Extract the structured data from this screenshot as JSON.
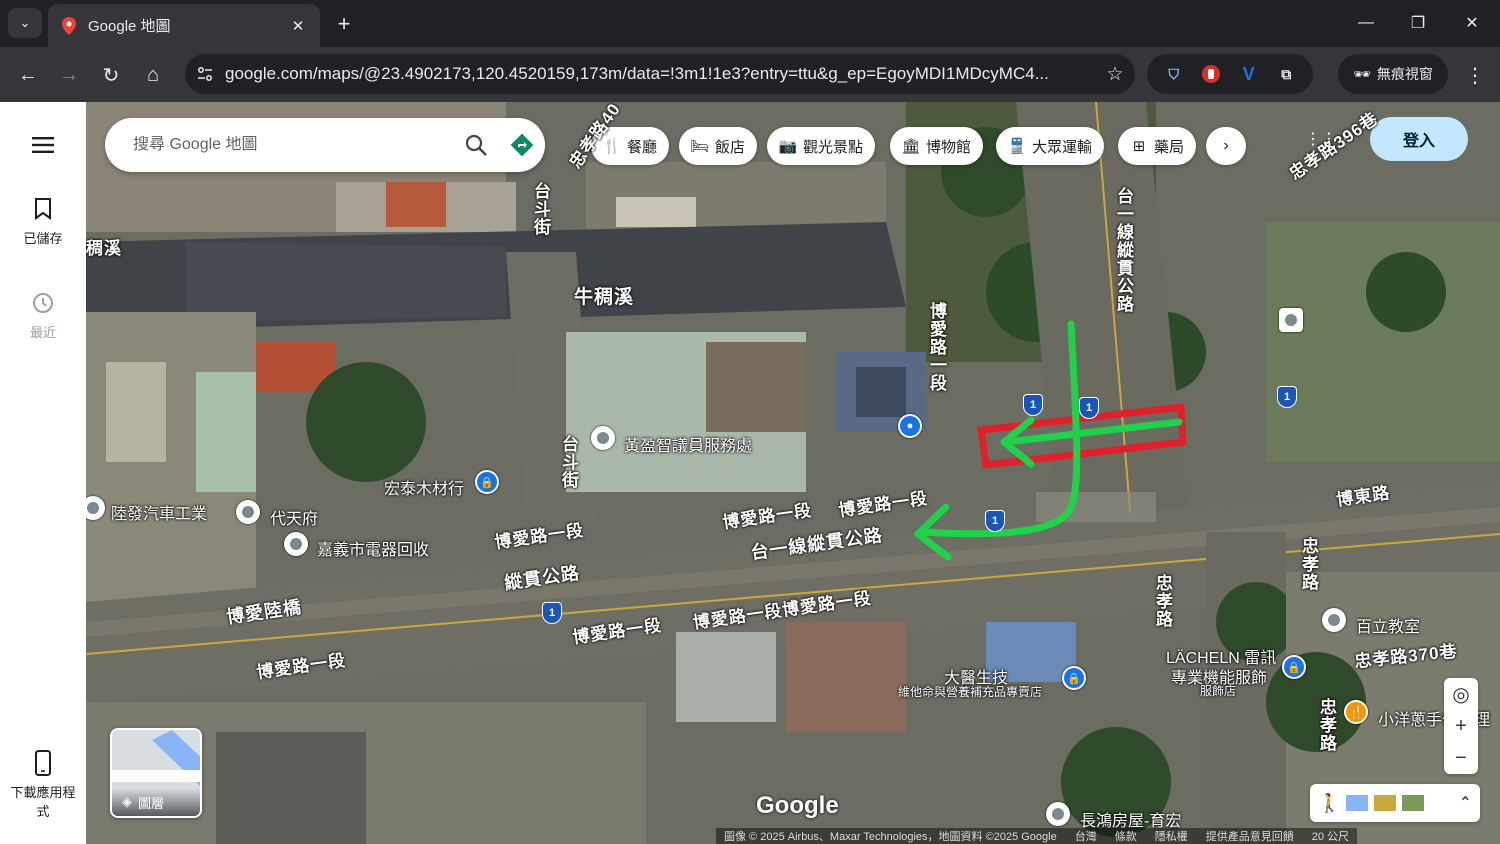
{
  "browser": {
    "tab_title": "Google 地圖",
    "url": "google.com/maps/@23.4902173,120.4520159,173m/data=!3m1!1e3?entry=ttu&g_ep=EgoyMDI1MDcyMC4...",
    "incognito_label": "無痕視窗"
  },
  "rail": {
    "menu_label": "",
    "saved_label": "已儲存",
    "recent_label": "最近",
    "download_label_1": "下載應用程",
    "download_label_2": "式"
  },
  "search": {
    "placeholder": "搜尋 Google 地圖"
  },
  "chips": [
    {
      "label": "餐廳",
      "icon": "restaurant-icon"
    },
    {
      "label": "飯店",
      "icon": "hotel-icon"
    },
    {
      "label": "觀光景點",
      "icon": "camera-icon"
    },
    {
      "label": "博物館",
      "icon": "museum-icon"
    },
    {
      "label": "大眾運輸",
      "icon": "transit-icon"
    },
    {
      "label": "藥局",
      "icon": "pharmacy-icon"
    }
  ],
  "signin_label": "登入",
  "map_labels": {
    "river_left": "稠溪",
    "river": "牛稠溪",
    "road_taidou_1": "台斗街",
    "road_taidou_2": "台斗街",
    "road_zhongxiao_40": "忠孝路40",
    "road_zhongxiao_396": "忠孝路396巷",
    "road_boai_1_vertical": "博愛路一段",
    "road_tai1_vertical": "台一線縱貫公路",
    "poi_huang": "黃盈智議員服務處",
    "poi_hongtai": "宏泰木材行",
    "poi_lufa": "陸發汽車工業",
    "poi_daitian": "代天府",
    "poi_chiayi": "嘉義市電器回收",
    "road_boai_a": "博愛路一段",
    "road_boai_b": "博愛路一段",
    "road_boai_c": "博愛路一段",
    "road_tai1": "台一線縱貫公路",
    "road_zonggun": "縱貫公路",
    "road_boai_bridge": "博愛陸橋",
    "road_boai_d": "博愛路一段",
    "road_boai_e": "博愛路一段",
    "road_boai_f": "博愛路一段博愛路一段",
    "road_bodong": "博東路",
    "road_zhongxiao_a": "忠孝路",
    "road_zhongxiao_b": "忠孝路",
    "road_zhongxiao_c": "忠孝路",
    "poi_baili": "百立教室",
    "road_zhongxiao_370": "忠孝路370巷",
    "poi_lacheln_1": "LÄCHELN 雷訊",
    "poi_lacheln_2": "專業機能服飾",
    "poi_lacheln_3": "服飾店",
    "poi_dayi_1": "大醫生技",
    "poi_dayi_2": "維他命與營養補充品專賣店",
    "poi_xiaoyang": "小洋蔥手作料理",
    "poi_changhong": "長鴻房屋-育宏",
    "layers_label": "圖層",
    "google_logo": "Google"
  },
  "highway_shield": "1",
  "attribution": {
    "imagery": "圖像 © 2025 Airbus、Maxar Technologies，地圖資料 ©2025 Google",
    "country": "台灣",
    "terms": "條款",
    "privacy": "隱私權",
    "feedback": "提供產品意見回饋",
    "scale": "20 公尺"
  },
  "annotation_colors": {
    "arrow": "#1ed24a",
    "box": "#e0202a"
  }
}
